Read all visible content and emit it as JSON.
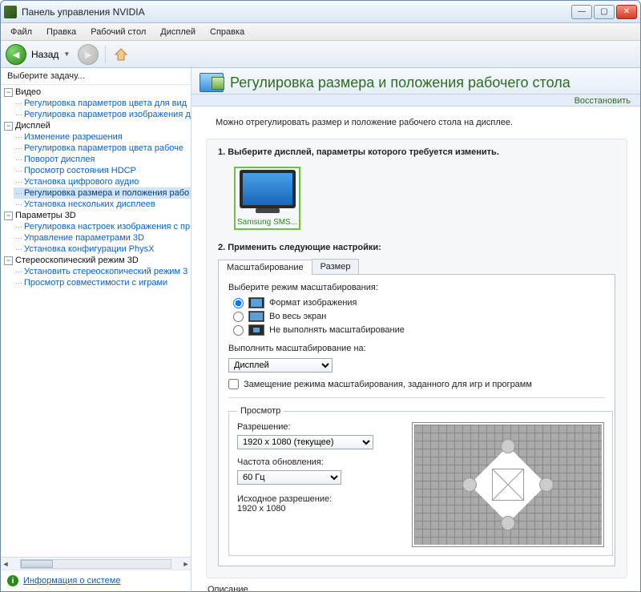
{
  "window": {
    "title": "Панель управления NVIDIA"
  },
  "menu": {
    "file": "Файл",
    "edit": "Правка",
    "desktop": "Рабочий стол",
    "display": "Дисплей",
    "help": "Справка"
  },
  "toolbar": {
    "back_label": "Назад"
  },
  "sidebar": {
    "header": "Выберите задачу...",
    "info_link": "Информация о системе",
    "cat_video": "Видео",
    "video_items": [
      "Регулировка параметров цвета для вид",
      "Регулировка параметров изображения д"
    ],
    "cat_display": "Дисплей",
    "display_items": [
      "Изменение разрешения",
      "Регулировка параметров цвета рабоче",
      "Поворот дисплея",
      "Просмотр состояния HDCP",
      "Установка цифрового аудио",
      "Регулировка размера и положения рабо",
      "Установка нескольких дисплеев"
    ],
    "cat_3d": "Параметры 3D",
    "p3d_items": [
      "Регулировка настроек изображения с пр",
      "Управление параметрами 3D",
      "Установка конфигурации PhysX"
    ],
    "cat_stereo": "Стереоскопический режим 3D",
    "stereo_items": [
      "Установить стереоскопический режим 3",
      "Просмотр совместимости с играми"
    ]
  },
  "header": {
    "title": "Регулировка размера и положения рабочего стола",
    "restore": "Восстановить"
  },
  "body": {
    "description": "Можно отрегулировать размер и положение рабочего стола на дисплее.",
    "step1_title": "1. Выберите дисплей, параметры которого требуется изменить.",
    "monitor_label": "Samsung SMS...",
    "step2_title": "2. Применить следующие настройки:",
    "tabs": {
      "scaling": "Масштабирование",
      "size": "Размер"
    },
    "scaling_mode_label": "Выберите режим масштабирования:",
    "radio_aspect": "Формат изображения",
    "radio_full": "Во весь экран",
    "radio_none": "Не выполнять масштабирование",
    "perform_on_label": "Выполнить масштабирование на:",
    "perform_on_options": [
      "Дисплей"
    ],
    "perform_on_selected": "Дисплей",
    "override_check": "Замещение режима масштабирования, заданного для игр и программ",
    "preview_legend": "Просмотр",
    "resolution_label": "Разрешение:",
    "resolution_options": [
      "1920 x 1080 (текущее)"
    ],
    "resolution_selected": "1920 x 1080 (текущее)",
    "refresh_label": "Частота обновления:",
    "refresh_options": [
      "60 Гц"
    ],
    "refresh_selected": "60 Гц",
    "native_label": "Исходное разрешение:",
    "native_value": "1920 x 1080",
    "bottom_desc": "Описание."
  }
}
